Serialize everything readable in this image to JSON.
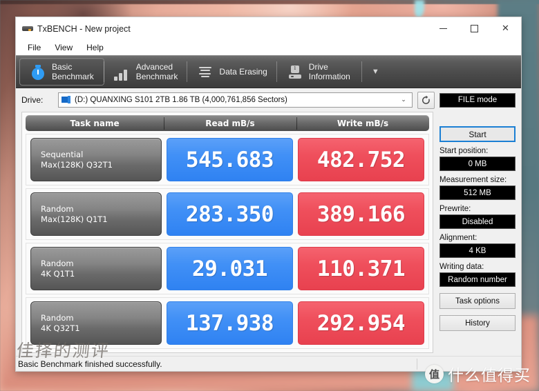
{
  "window": {
    "title": "TxBENCH - New project",
    "app_icon": "drive-icon",
    "controls": {
      "minimize": "minimize-icon",
      "maximize": "maximize-icon",
      "close": "close-icon"
    }
  },
  "menubar": {
    "items": [
      {
        "label": "File"
      },
      {
        "label": "View"
      },
      {
        "label": "Help"
      }
    ]
  },
  "toolbar": {
    "tabs": [
      {
        "line1": "Basic",
        "line2": "Benchmark",
        "icon": "stopwatch-icon",
        "active": true
      },
      {
        "line1": "Advanced",
        "line2": "Benchmark",
        "icon": "bar-chart-icon",
        "active": false
      },
      {
        "line1": "Data Erasing",
        "line2": "",
        "icon": "eraser-icon",
        "active": false
      },
      {
        "line1": "Drive",
        "line2": "Information",
        "icon": "drive-info-icon",
        "active": false
      }
    ],
    "overflow_label": "▼"
  },
  "drive_row": {
    "label": "Drive:",
    "selected": "(D:) QUANXING S101 2TB  1.86 TB (4,000,761,856 Sectors)",
    "caret": "⌄",
    "refresh_icon": "refresh-icon",
    "mode_button": "FILE mode"
  },
  "results": {
    "columns": [
      "Task name",
      "Read mB/s",
      "Write mB/s"
    ],
    "rows": [
      {
        "task_line1": "Sequential",
        "task_line2": "Max(128K) Q32T1",
        "read": "545.683",
        "write": "482.752"
      },
      {
        "task_line1": "Random",
        "task_line2": "Max(128K) Q1T1",
        "read": "283.350",
        "write": "389.166"
      },
      {
        "task_line1": "Random",
        "task_line2": "4K Q1T1",
        "read": "29.031",
        "write": "110.371"
      },
      {
        "task_line1": "Random",
        "task_line2": "4K Q32T1",
        "read": "137.938",
        "write": "292.954"
      }
    ]
  },
  "sidebar": {
    "start_button": "Start",
    "fields": [
      {
        "label": "Start position:",
        "value": "0 MB"
      },
      {
        "label": "Measurement size:",
        "value": "512 MB"
      },
      {
        "label": "Prewrite:",
        "value": "Disabled"
      },
      {
        "label": "Alignment:",
        "value": "4 KB"
      },
      {
        "label": "Writing data:",
        "value": "Random number"
      }
    ],
    "buttons": [
      {
        "label": "Task options"
      },
      {
        "label": "History"
      }
    ]
  },
  "statusbar": {
    "message": "Basic Benchmark finished successfully."
  },
  "watermark": {
    "badge": "值",
    "text": "什么值得买"
  },
  "handwriting": {
    "text": "佳择的测评"
  },
  "colors": {
    "read_blue": "#3d8ef5",
    "write_red": "#ef4f5c",
    "accent_blue": "#1b7fd4",
    "toolbar_dark": "#4c4c4c"
  }
}
